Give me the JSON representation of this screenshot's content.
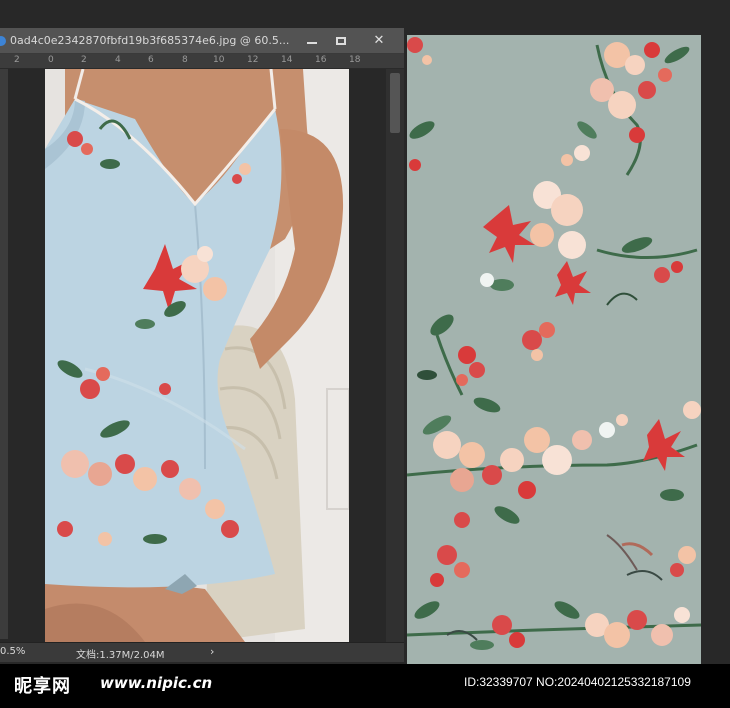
{
  "window": {
    "title": "0ad4c0e2342870fbfd19b3f685374e6.jpg @ 60.5...",
    "minimize_icon": "minimize-icon",
    "maximize_icon": "maximize-icon",
    "close_icon": "close-icon",
    "close_glyph": "✕"
  },
  "ruler": {
    "ticks": [
      "2",
      "0",
      "2",
      "4",
      "6",
      "8",
      "10",
      "12",
      "14",
      "16",
      "18"
    ]
  },
  "status": {
    "zoom": "0.5%",
    "doc_size": "文档:1.37M/2.04M",
    "arrow": "›"
  },
  "colors": {
    "ui_dark": "#282828",
    "title_bar": "#535353",
    "pattern_bg": "#a3b3ae",
    "dress": "#bcd4e2",
    "flower_red": "#d93a3a",
    "flower_peach": "#f3c3a6",
    "leaf_green": "#3e6b4a"
  },
  "watermark": {
    "logo": "昵享网",
    "url": "www.nipic.cn",
    "id": "ID:32339707 NO:20240402125332187109"
  }
}
